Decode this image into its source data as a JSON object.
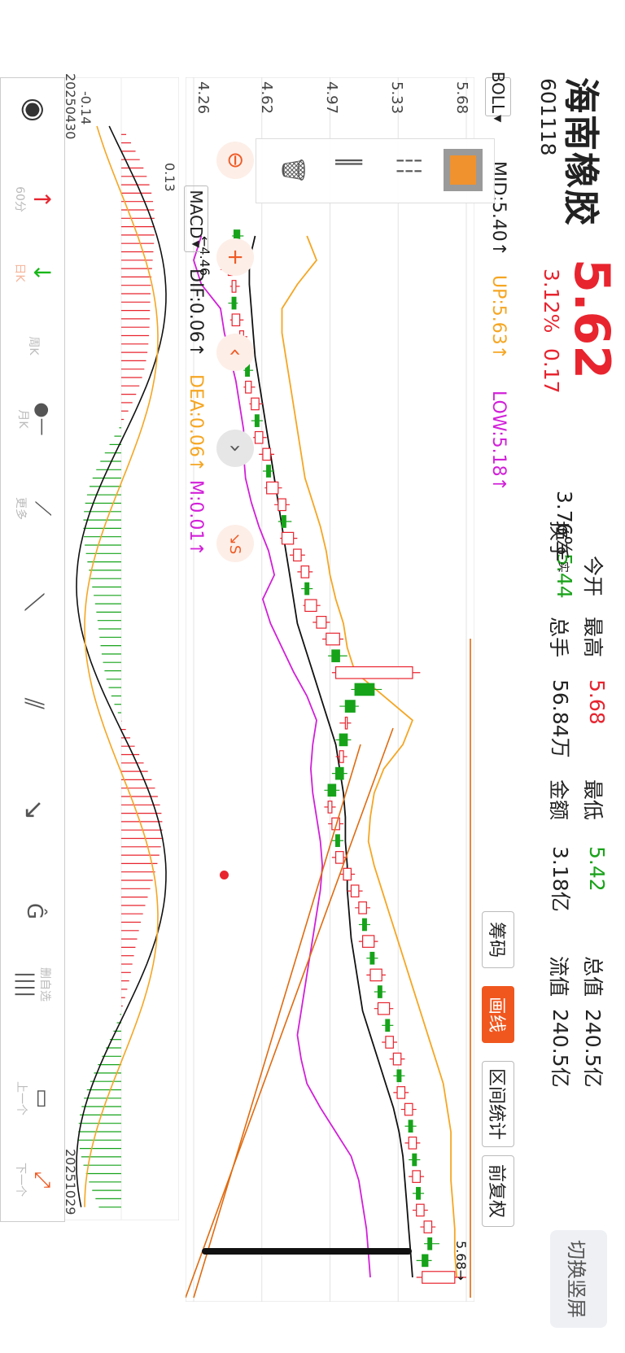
{
  "header": {
    "stock_name": "海南橡胶",
    "price": "5.62",
    "code": "601118",
    "change_pct": "3.12%",
    "change": "0.17",
    "switch_label": "切换竖屏"
  },
  "quote": [
    {
      "label": "今开",
      "value": "5.44",
      "color": "#1aa31a"
    },
    {
      "label": "换手",
      "label_sup": "实",
      "value": "3.76%",
      "color": "#222222"
    },
    {
      "label": "最高",
      "value": "5.68",
      "color": "#e8242f"
    },
    {
      "label": "总手",
      "value": "56.84万",
      "color": "#222222"
    },
    {
      "label": "最低",
      "value": "5.42",
      "color": "#1aa31a"
    },
    {
      "label": "金额",
      "value": "3.18亿",
      "color": "#222222"
    },
    {
      "label": "总值",
      "value": "240.5亿",
      "color": "#222222"
    },
    {
      "label": "流值",
      "value": "240.5亿",
      "color": "#222222"
    }
  ],
  "tabs": {
    "chips": "筹码",
    "draw_line": "画线",
    "interval_stats": "区间统计",
    "forward_adjust": "前复权"
  },
  "indicator": {
    "name": "BOLL",
    "mid": "MID:5.40↑",
    "up": "UP:5.63↑",
    "low": "LOW:5.18↑"
  },
  "macd": {
    "name": "MACD",
    "dif": "DIF:0.06↑",
    "dea": "DEA:0.06↑",
    "m": "M:0.01↑"
  },
  "price_axis": [
    "5.68",
    "5.33",
    "4.97",
    "4.62",
    "4.26"
  ],
  "macd_axis": [
    "0.13",
    "-0.14"
  ],
  "dates": {
    "start": "20250430",
    "end": "20251029"
  },
  "markers": {
    "min_label": "←4.46",
    "max_label": "5.68→"
  },
  "toolbar": {
    "items": [
      "60分",
      "日K",
      "周K",
      "月K",
      "更多",
      "",
      "",
      "",
      "",
      "删自选",
      "",
      "上一个",
      "下一个"
    ]
  },
  "colors": {
    "up": "#e8242f",
    "down": "#16a31a",
    "mid": "#111111",
    "upper": "#f5a623",
    "lower": "#d21fd9",
    "accent": "#f0571f"
  },
  "chart_data": {
    "type": "candlestick",
    "title": "海南橡胶",
    "x_range": [
      "20250430",
      "20251029"
    ],
    "ylim": [
      4.26,
      5.68
    ],
    "series": [
      {
        "name": "MID",
        "values": [
          4.58,
          4.55,
          4.55,
          4.56,
          4.57,
          4.58,
          4.6,
          4.62,
          4.64,
          4.66,
          4.68,
          4.7,
          4.72,
          4.74,
          4.76,
          4.78,
          4.8,
          4.84,
          4.88,
          4.92,
          4.96,
          5.0,
          5.02,
          5.04,
          5.05,
          5.05,
          5.06,
          5.06,
          5.07,
          5.08,
          5.1,
          5.12,
          5.14,
          5.18,
          5.22,
          5.26,
          5.3,
          5.33,
          5.35,
          5.36,
          5.37,
          5.38,
          5.39,
          5.4
        ]
      },
      {
        "name": "UP",
        "values": [
          4.85,
          4.9,
          4.8,
          4.72,
          4.72,
          4.74,
          4.76,
          4.78,
          4.8,
          4.82,
          4.84,
          4.88,
          4.92,
          4.95,
          4.97,
          5.0,
          5.04,
          5.06,
          5.1,
          5.25,
          5.4,
          5.35,
          5.25,
          5.2,
          5.18,
          5.17,
          5.2,
          5.24,
          5.28,
          5.32,
          5.36,
          5.4,
          5.44,
          5.48,
          5.52,
          5.56,
          5.58,
          5.6,
          5.6,
          5.6,
          5.61,
          5.62,
          5.62,
          5.63
        ]
      },
      {
        "name": "LOW",
        "values": [
          4.3,
          4.26,
          4.3,
          4.4,
          4.42,
          4.45,
          4.48,
          4.5,
          4.52,
          4.52,
          4.53,
          4.56,
          4.6,
          4.65,
          4.68,
          4.62,
          4.66,
          4.72,
          4.78,
          4.85,
          4.9,
          4.88,
          4.87,
          4.88,
          4.9,
          4.92,
          4.93,
          4.92,
          4.9,
          4.88,
          4.86,
          4.84,
          4.82,
          4.8,
          4.82,
          4.85,
          4.92,
          5.0,
          5.08,
          5.12,
          5.14,
          5.16,
          5.17,
          5.18
        ]
      }
    ],
    "candles": [
      [
        4.5,
        4.47,
        4.52,
        4.46
      ],
      [
        4.47,
        4.43,
        4.48,
        4.42
      ],
      [
        4.44,
        4.46,
        4.48,
        4.4
      ],
      [
        4.46,
        4.48,
        4.5,
        4.45
      ],
      [
        4.48,
        4.46,
        4.49,
        4.44
      ],
      [
        4.46,
        4.5,
        4.52,
        4.45
      ],
      [
        4.5,
        4.52,
        4.54,
        4.48
      ],
      [
        4.52,
        4.55,
        4.56,
        4.5
      ],
      [
        4.55,
        4.53,
        4.57,
        4.52
      ],
      [
        4.53,
        4.56,
        4.58,
        4.52
      ],
      [
        4.56,
        4.6,
        4.62,
        4.55
      ],
      [
        4.6,
        4.58,
        4.62,
        4.56
      ],
      [
        4.58,
        4.62,
        4.64,
        4.57
      ],
      [
        4.62,
        4.66,
        4.68,
        4.6
      ],
      [
        4.66,
        4.64,
        4.68,
        4.62
      ],
      [
        4.64,
        4.7,
        4.72,
        4.63
      ],
      [
        4.7,
        4.74,
        4.76,
        4.68
      ],
      [
        4.74,
        4.72,
        4.77,
        4.7
      ],
      [
        4.72,
        4.78,
        4.8,
        4.71
      ],
      [
        4.78,
        4.82,
        4.84,
        4.76
      ],
      [
        4.82,
        4.86,
        4.88,
        4.8
      ],
      [
        4.86,
        4.84,
        4.88,
        4.82
      ],
      [
        4.84,
        4.9,
        4.92,
        4.83
      ],
      [
        4.9,
        4.95,
        4.97,
        4.88
      ],
      [
        4.95,
        5.02,
        5.04,
        4.93
      ],
      [
        5.02,
        4.98,
        5.06,
        4.96
      ],
      [
        5.0,
        5.4,
        5.44,
        4.98
      ],
      [
        5.2,
        5.1,
        5.24,
        5.08
      ],
      [
        5.1,
        5.05,
        5.12,
        5.02
      ],
      [
        5.05,
        5.06,
        5.08,
        5.02
      ],
      [
        5.06,
        5.02,
        5.08,
        5.0
      ],
      [
        5.02,
        5.04,
        5.06,
        5.0
      ],
      [
        5.04,
        5.0,
        5.06,
        4.98
      ],
      [
        5.0,
        4.96,
        5.02,
        4.94
      ],
      [
        4.96,
        4.98,
        5.0,
        4.94
      ],
      [
        4.98,
        5.02,
        5.04,
        4.96
      ],
      [
        5.02,
        5.0,
        5.04,
        4.98
      ],
      [
        5.0,
        5.04,
        5.06,
        4.98
      ],
      [
        5.04,
        5.08,
        5.1,
        5.02
      ],
      [
        5.08,
        5.12,
        5.14,
        5.06
      ],
      [
        5.12,
        5.16,
        5.18,
        5.1
      ],
      [
        5.16,
        5.14,
        5.18,
        5.12
      ],
      [
        5.14,
        5.2,
        5.22,
        5.12
      ],
      [
        5.2,
        5.18,
        5.22,
        5.16
      ],
      [
        5.18,
        5.24,
        5.26,
        5.16
      ],
      [
        5.24,
        5.22,
        5.26,
        5.2
      ],
      [
        5.22,
        5.28,
        5.3,
        5.2
      ],
      [
        5.28,
        5.26,
        5.3,
        5.24
      ],
      [
        5.26,
        5.3,
        5.32,
        5.24
      ],
      [
        5.3,
        5.34,
        5.36,
        5.28
      ],
      [
        5.34,
        5.32,
        5.36,
        5.3
      ],
      [
        5.32,
        5.36,
        5.38,
        5.3
      ],
      [
        5.36,
        5.4,
        5.42,
        5.34
      ],
      [
        5.4,
        5.38,
        5.42,
        5.36
      ],
      [
        5.38,
        5.42,
        5.44,
        5.36
      ],
      [
        5.42,
        5.4,
        5.44,
        5.38
      ],
      [
        5.4,
        5.44,
        5.46,
        5.38
      ],
      [
        5.44,
        5.42,
        5.46,
        5.4
      ],
      [
        5.42,
        5.46,
        5.48,
        5.4
      ],
      [
        5.46,
        5.5,
        5.52,
        5.44
      ],
      [
        5.5,
        5.48,
        5.54,
        5.46
      ],
      [
        5.48,
        5.45,
        5.5,
        5.42
      ],
      [
        5.45,
        5.62,
        5.68,
        5.42
      ]
    ]
  }
}
